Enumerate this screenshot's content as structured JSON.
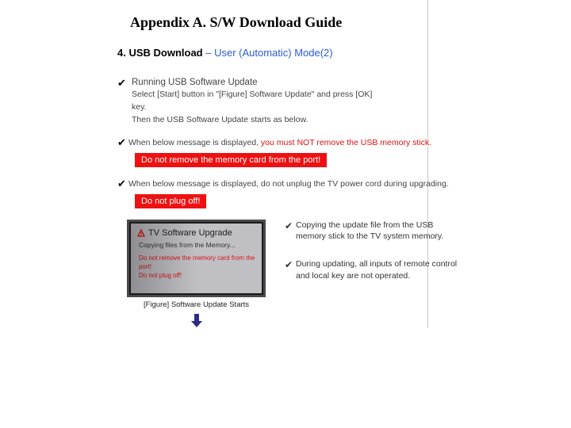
{
  "title": "Appendix A. S/W Download Guide",
  "section_num": "4. USB Download",
  "section_sub": " – User (Automatic) Mode(2)",
  "b1": {
    "title": "Running USB Software Update",
    "l1": "Select [Start] button in \"[Figure] Software Update\" and press [OK]",
    "l2": "key.",
    "l3": "Then the USB Software Update starts as below."
  },
  "b2": {
    "lead": "When below message is displayed, ",
    "warn": "you must NOT remove the USB memory stick.",
    "box": "Do not remove the memory card from the port!"
  },
  "b3": {
    "lead": "When below message is displayed, ",
    "tail": "do not unplug the TV power cord during upgrading.",
    "box": "Do not plug off!"
  },
  "fig": {
    "head": "TV Software Upgrade",
    "sub": "Copying files from the Memory...",
    "r1": "Do not remove the memory card from the port!",
    "r2": "Do not plug off!",
    "caption": "[Figure] Software Update Starts"
  },
  "side": {
    "n1": "Copying the update file from the USB memory stick to the TV system memory.",
    "n2": "During updating, all inputs of remote control and local key are not operated."
  }
}
